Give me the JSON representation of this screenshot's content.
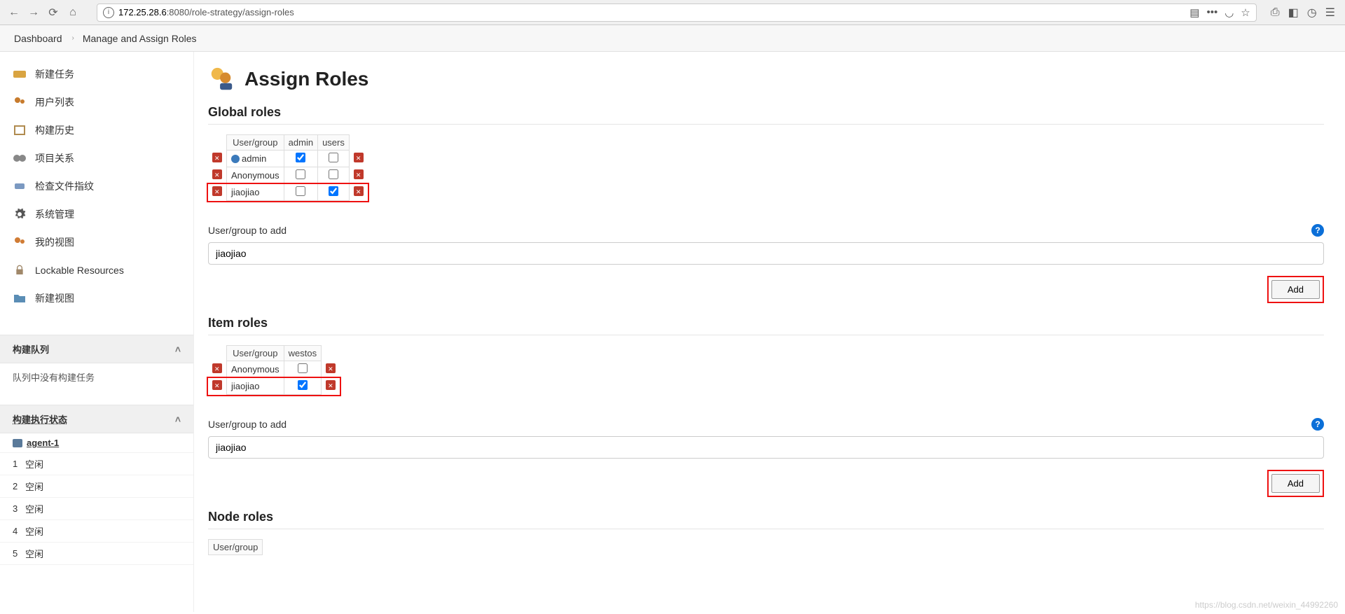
{
  "browser": {
    "url_host": "172.25.28.6",
    "url_path": ":8080/role-strategy/assign-roles"
  },
  "breadcrumb": {
    "items": [
      "Dashboard",
      "Manage and Assign Roles"
    ]
  },
  "sidebar": {
    "tasks": [
      {
        "label": "新建任务",
        "icon": "new-item-icon"
      },
      {
        "label": "用户列表",
        "icon": "people-icon"
      },
      {
        "label": "构建历史",
        "icon": "build-history-icon"
      },
      {
        "label": "项目关系",
        "icon": "project-relationship-icon"
      },
      {
        "label": "检查文件指纹",
        "icon": "fingerprint-icon"
      },
      {
        "label": "系统管理",
        "icon": "manage-icon"
      },
      {
        "label": "我的视图",
        "icon": "my-views-icon"
      },
      {
        "label": "Lockable Resources",
        "icon": "lock-icon"
      },
      {
        "label": "新建视图",
        "icon": "new-view-icon"
      }
    ],
    "build_queue_title": "构建队列",
    "build_queue_empty": "队列中没有构建任务",
    "executor_status_title": "构建执行状态",
    "agent_name": "agent-1",
    "executors": [
      {
        "num": "1",
        "status": "空闲"
      },
      {
        "num": "2",
        "status": "空闲"
      },
      {
        "num": "3",
        "status": "空闲"
      },
      {
        "num": "4",
        "status": "空闲"
      },
      {
        "num": "5",
        "status": "空闲"
      }
    ]
  },
  "page": {
    "title": "Assign Roles"
  },
  "global_roles": {
    "title": "Global roles",
    "columns": [
      "User/group",
      "admin",
      "users"
    ],
    "rows": [
      {
        "name": "admin",
        "has_user_icon": true,
        "checks": [
          true,
          false
        ],
        "highlighted": false
      },
      {
        "name": "Anonymous",
        "has_user_icon": false,
        "checks": [
          false,
          false
        ],
        "highlighted": false
      },
      {
        "name": "jiaojiao",
        "has_user_icon": false,
        "checks": [
          false,
          true
        ],
        "highlighted": true
      }
    ],
    "add_label": "User/group to add",
    "add_value": "jiaojiao",
    "add_button": "Add"
  },
  "item_roles": {
    "title": "Item roles",
    "columns": [
      "User/group",
      "westos"
    ],
    "rows": [
      {
        "name": "Anonymous",
        "checks": [
          false
        ],
        "highlighted": false
      },
      {
        "name": "jiaojiao",
        "checks": [
          true
        ],
        "highlighted": true
      }
    ],
    "add_label": "User/group to add",
    "add_value": "jiaojiao",
    "add_button": "Add"
  },
  "node_roles": {
    "title": "Node roles",
    "columns": [
      "User/group"
    ]
  },
  "watermark": "https://blog.csdn.net/weixin_44992260"
}
